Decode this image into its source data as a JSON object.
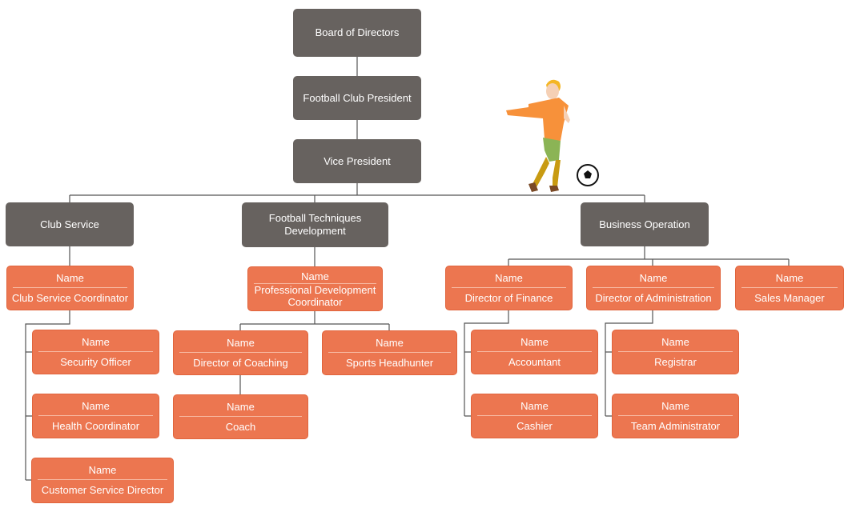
{
  "colors": {
    "executive": "#67625f",
    "position": "#ec7650",
    "line": "#555555"
  },
  "executives": {
    "board": "Board of Directors",
    "president": "Football Club President",
    "vice_president": "Vice President",
    "club_service": "Club Service",
    "techniques": "Football Techniques Development",
    "business": "Business Operation"
  },
  "positions": [
    {
      "name": "Name",
      "role": "Club Service Coordinator"
    },
    {
      "name": "Name",
      "role": "Security Officer"
    },
    {
      "name": "Name",
      "role": "Health Coordinator"
    },
    {
      "name": "Name",
      "role": "Customer Service Director"
    },
    {
      "name": "Name",
      "role": "Professional Development Coordinator"
    },
    {
      "name": "Name",
      "role": "Director of Coaching"
    },
    {
      "name": "Name",
      "role": "Coach"
    },
    {
      "name": "Name",
      "role": "Sports Headhunter"
    },
    {
      "name": "Name",
      "role": "Director of Finance"
    },
    {
      "name": "Name",
      "role": "Accountant"
    },
    {
      "name": "Name",
      "role": "Cashier"
    },
    {
      "name": "Name",
      "role": "Director of Administration"
    },
    {
      "name": "Name",
      "role": "Registrar"
    },
    {
      "name": "Name",
      "role": "Team Administrator"
    },
    {
      "name": "Name",
      "role": "Sales Manager"
    }
  ],
  "illustration": {
    "icon": "football-player-icon",
    "ball": "soccer-ball-icon"
  }
}
